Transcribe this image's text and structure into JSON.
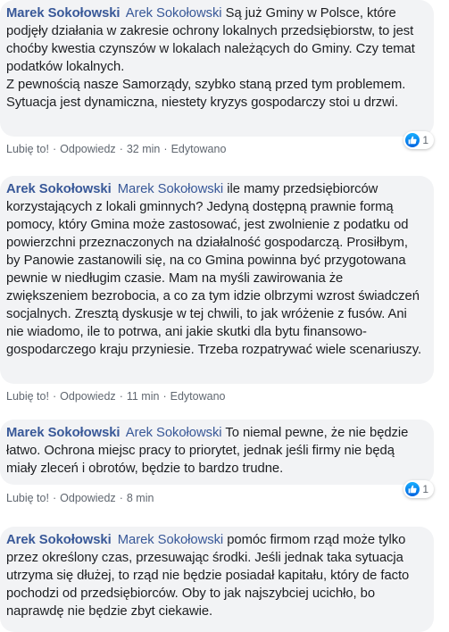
{
  "comments": [
    {
      "author": "Marek Sokołowski",
      "mention": "Arek Sokołowski",
      "text": "Są już Gminy w Polsce, które podjęły działania w zakresie ochrony lokalnych przedsiębiorstw, to jest choćby kwestia czynszów w lokalach należących do Gminy. Czy temat podatków lokalnych.\nZ pewnością nasze Samorządy, szybko staną przed tym problemem. Sytuacja jest dynamiczna, niestety kryzys gospodarczy stoi u drzwi.",
      "like_label": "Lubię to!",
      "reply_label": "Odpowiedz",
      "time": "32 min",
      "edited_label": "Edytowano",
      "reaction_count": "1"
    },
    {
      "author": "Arek Sokołowski",
      "mention": "Marek Sokołowski",
      "text": "ile mamy przedsiębiorców korzystających z lokali gminnych? Jedyną dostępną prawnie formą pomocy, który Gmina może zastosować, jest zwolnienie z podatku od powierzchni przeznaczonych na działalność gospodarczą. Prosiłbym, by Panowie zastanowili się, na co Gmina powinna być przygotowana pewnie w niedługim czasie. Mam na myśli zawirowania że zwiększeniem bezrobocia, a co za tym idzie olbrzymi wzrost świadczeń socjalnych. Zresztą dyskusje w tej chwili, to jak wróżenie z fusów. Ani nie wiadomo, ile to potrwa, ani jakie skutki dla bytu finansowo-gospodarczego kraju przyniesie. Trzeba rozpatrywać wiele scenariuszy.",
      "like_label": "Lubię to!",
      "reply_label": "Odpowiedz",
      "time": "11 min",
      "edited_label": "Edytowano"
    },
    {
      "author": "Marek Sokołowski",
      "mention": "Arek Sokołowski",
      "text": "To niemal pewne, że nie będzie łatwo. Ochrona miejsc pracy to priorytet, jednak jeśli firmy nie będą miały zleceń i obrotów, będzie to bardzo trudne.",
      "like_label": "Lubię to!",
      "reply_label": "Odpowiedz",
      "time": "8 min",
      "reaction_count": "1"
    },
    {
      "author": "Arek Sokołowski",
      "mention": "Marek Sokołowski",
      "text": "pomóc firmom rząd może tylko przez określony czas, przesuwając środki. Jeśli jednak taka sytuacja utrzyma się dłużej, to rząd nie będzie posiadał kapitału, który de facto pochodzi od przedsiębiorców. Oby to jak najszybciej ucichło, bo naprawdę nie będzie zbyt ciekawie."
    }
  ],
  "colors": {
    "bubble_bg": "#f2f3f5",
    "author": "#385898",
    "meta": "#606770",
    "like_blue": "#1877f2"
  },
  "icons": {
    "reaction": "thumbs-up-icon"
  }
}
